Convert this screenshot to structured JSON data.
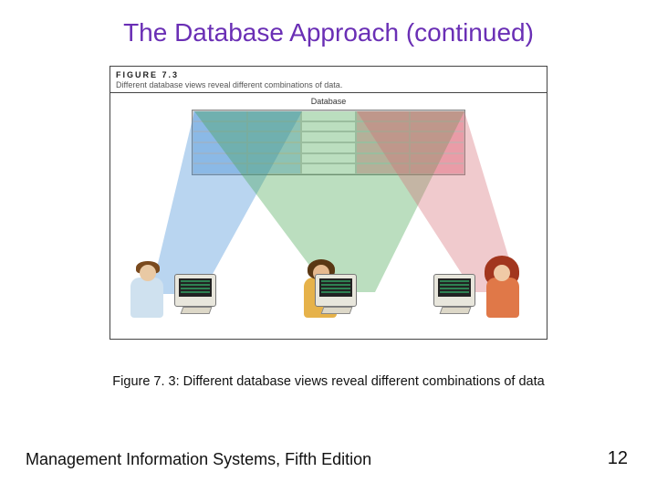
{
  "title": "The Database Approach (continued)",
  "figure": {
    "label": "FIGURE 7.3",
    "subtitle": "Different database views reveal different combinations of data.",
    "db_label": "Database"
  },
  "caption": "Figure 7. 3: Different database views reveal different combinations of data",
  "footer": {
    "left": "Management Information Systems, Fifth Edition",
    "page": "12"
  }
}
